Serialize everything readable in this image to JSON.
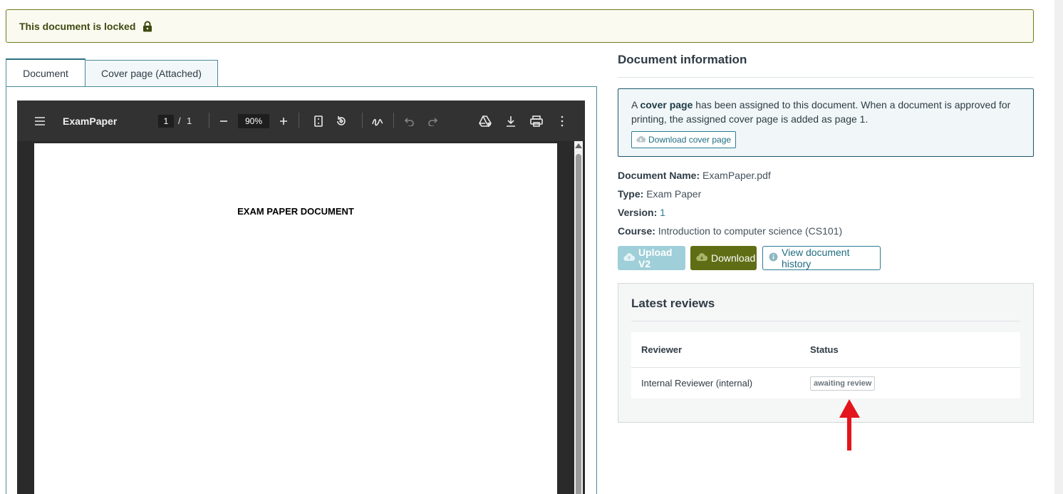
{
  "lock_banner": {
    "text": "This document is locked"
  },
  "tabs": [
    {
      "label": "Document",
      "active": true
    },
    {
      "label": "Cover page (Attached)",
      "active": false
    }
  ],
  "pdf_viewer": {
    "title": "ExamPaper",
    "current_page": "1",
    "page_separator": "/",
    "total_pages": "1",
    "zoom": "90%",
    "page_heading": "EXAM PAPER DOCUMENT"
  },
  "info": {
    "title": "Document information",
    "cover_notice": {
      "prefix": "A ",
      "bold": "cover page",
      "suffix": " has been assigned to this document. When a document is approved for printing, the assigned cover page is added as page 1.",
      "button": "Download cover page"
    },
    "fields": {
      "name_label": "Document Name:",
      "name_value": "ExamPaper.pdf",
      "type_label": "Type:",
      "type_value": "Exam Paper",
      "version_label": "Version:",
      "version_value": "1",
      "course_label": "Course:",
      "course_value": "Introduction to computer science (CS101)"
    },
    "buttons": {
      "upload": "Upload V2",
      "download": "Download",
      "history": "View document history"
    }
  },
  "reviews": {
    "title": "Latest reviews",
    "headers": {
      "reviewer": "Reviewer",
      "status": "Status"
    },
    "rows": [
      {
        "reviewer": "Internal Reviewer (internal)",
        "status": "awaiting review"
      }
    ]
  },
  "colors": {
    "accent": "#2a7d92",
    "olive": "#5f6e14",
    "annotation_arrow": "#e3141b"
  }
}
